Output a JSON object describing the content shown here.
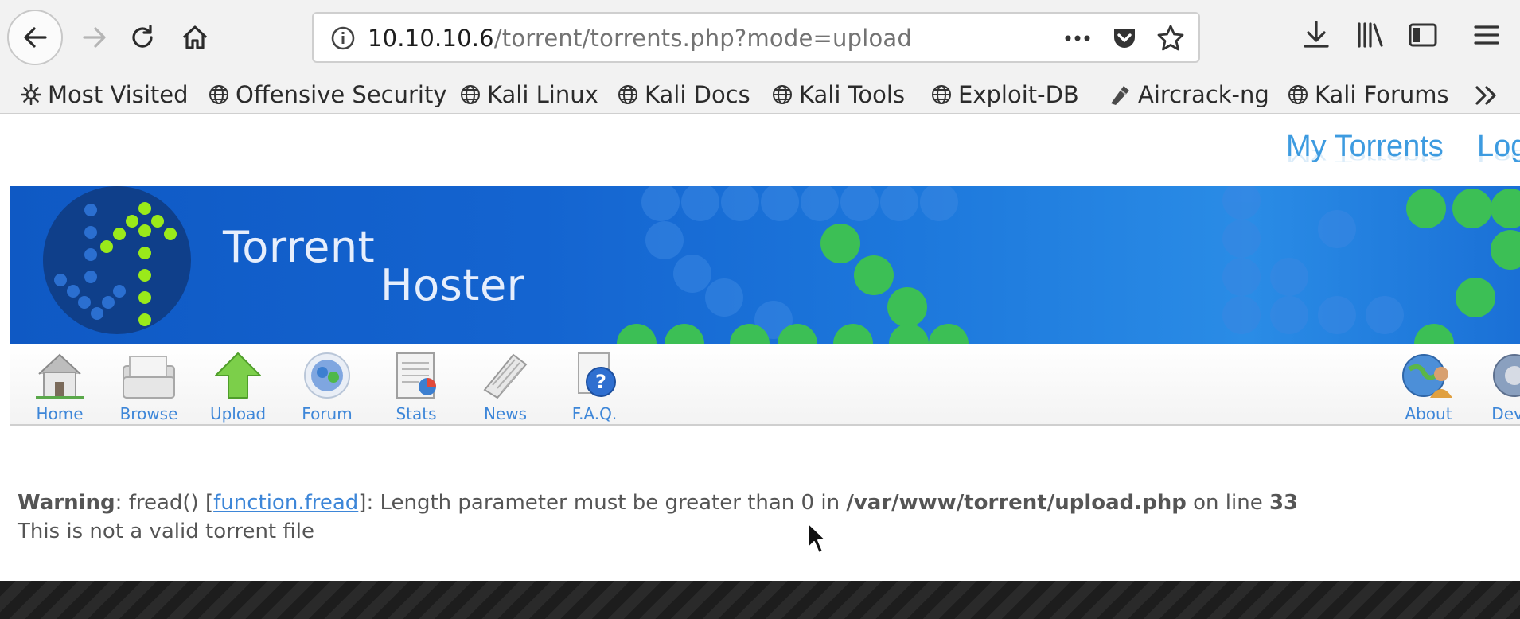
{
  "browser": {
    "url_host": "10.10.10.6",
    "url_path": "/torrent/torrents.php?mode=upload",
    "bookmarks": [
      {
        "label": "Most Visited",
        "icon": "gear-icon"
      },
      {
        "label": "Offensive Security",
        "icon": "globe-icon"
      },
      {
        "label": "Kali Linux",
        "icon": "globe-icon"
      },
      {
        "label": "Kali Docs",
        "icon": "globe-icon"
      },
      {
        "label": "Kali Tools",
        "icon": "globe-icon"
      },
      {
        "label": "Exploit-DB",
        "icon": "globe-icon"
      },
      {
        "label": "Aircrack-ng",
        "icon": "aircrack-icon"
      },
      {
        "label": "Kali Forums",
        "icon": "globe-icon"
      }
    ]
  },
  "site": {
    "top_links": [
      "My Torrents",
      "Log"
    ],
    "banner_title_line1": "Torrent",
    "banner_title_line2": "Hoster",
    "menu": [
      {
        "label": "Home",
        "icon": "home-icon"
      },
      {
        "label": "Browse",
        "icon": "browse-icon"
      },
      {
        "label": "Upload",
        "icon": "upload-icon"
      },
      {
        "label": "Forum",
        "icon": "forum-icon"
      },
      {
        "label": "Stats",
        "icon": "stats-icon"
      },
      {
        "label": "News",
        "icon": "news-icon"
      },
      {
        "label": "F.A.Q.",
        "icon": "faq-icon"
      }
    ],
    "menu_right": [
      {
        "label": "About",
        "icon": "about-icon"
      },
      {
        "label": "Devel",
        "icon": "devel-icon"
      }
    ]
  },
  "message": {
    "warning_label": "Warning",
    "warning_prefix": ": fread() [",
    "warning_link": "function.fread",
    "warning_middle": "]: Length parameter must be greater than 0 in ",
    "warning_path": "/var/www/torrent/upload.php",
    "warning_line_text": " on line ",
    "warning_line": "33",
    "info": "This is not a valid torrent file"
  },
  "colors": {
    "link": "#3d86d8",
    "banner": "#1464d0",
    "accent_green": "#9aea1a"
  }
}
